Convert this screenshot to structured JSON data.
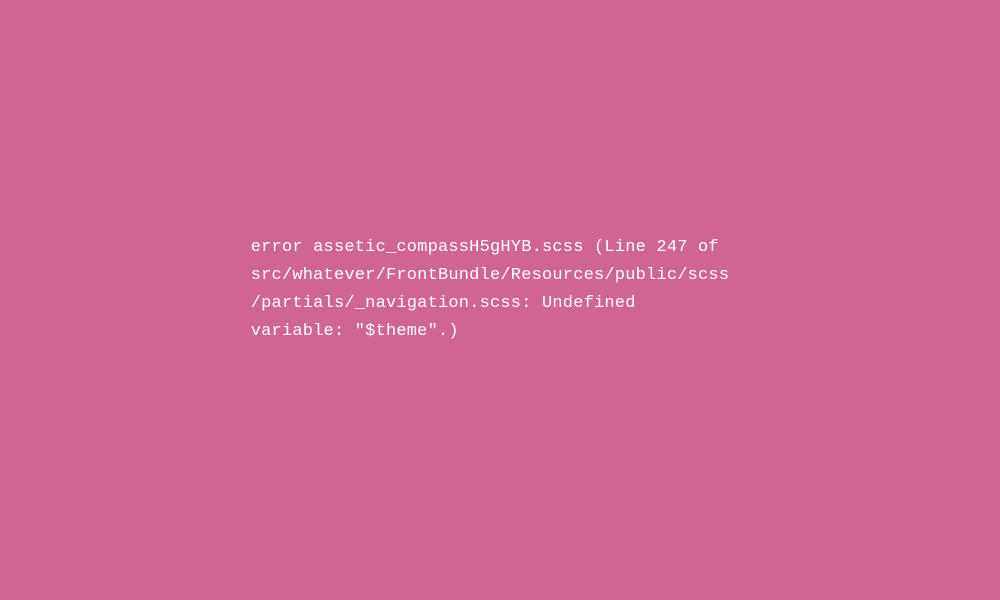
{
  "error": {
    "line1": "error assetic_compassH5gHYB.scss (Line 247 of",
    "line2": "src/whatever/FrontBundle/Resources/public/scss",
    "line3": "/partials/_navigation.scss: Undefined",
    "line4": "variable: \"$theme\".)"
  }
}
